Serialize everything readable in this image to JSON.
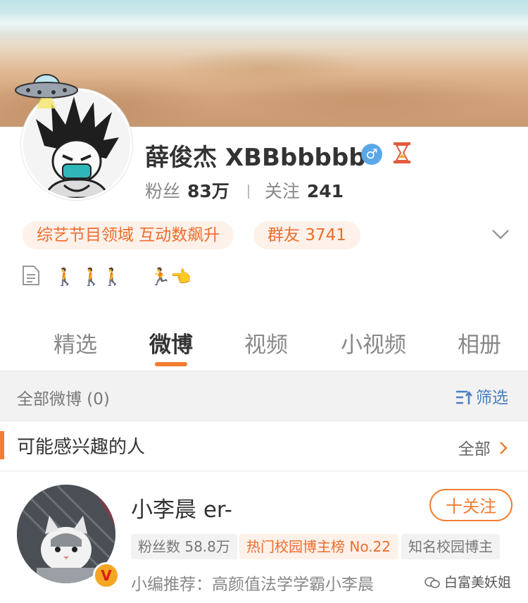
{
  "profile": {
    "name": "薛俊杰 XBBbbbbb",
    "gender_symbol": "♂",
    "fans_label": "粉丝",
    "fans_count": "83万",
    "following_label": "关注",
    "following_count": "241"
  },
  "tags": {
    "domain": "综艺节目领域 互动数飙升",
    "group": "群友 3741"
  },
  "bio_emojis": "🚶 🚶🚶     🏃👈",
  "tabs": [
    "精选",
    "微博",
    "视频",
    "小视频",
    "相册"
  ],
  "active_tab": "微博",
  "filter_bar": {
    "all_label": "全部微博 (0)",
    "filter_label": "筛选"
  },
  "recommend": {
    "title": "可能感兴趣的人",
    "more_label": "全部"
  },
  "person": {
    "name": "小李晨 er-",
    "follow_label": "十关注",
    "badge_symbol": "V",
    "tags": [
      "粉丝数 58.8万",
      "热门校园博主榜 No.22",
      "知名校园博主"
    ],
    "recommendation": "小编推荐：高颜值法学学霸小李晨"
  },
  "watermark": "白富美妖姐",
  "colors": {
    "accent": "#f47c30",
    "tag_text": "#ee6d2c",
    "tag_bg": "#fdf1ea",
    "filter_link": "#4a7fbf",
    "gender_badge": "#5aa7e8"
  },
  "icons": [
    "ufo-icon",
    "male-icon",
    "hourglass-icon",
    "chevron-down-icon",
    "document-icon",
    "filter-icon",
    "chevron-right-icon",
    "wechat-icon"
  ]
}
